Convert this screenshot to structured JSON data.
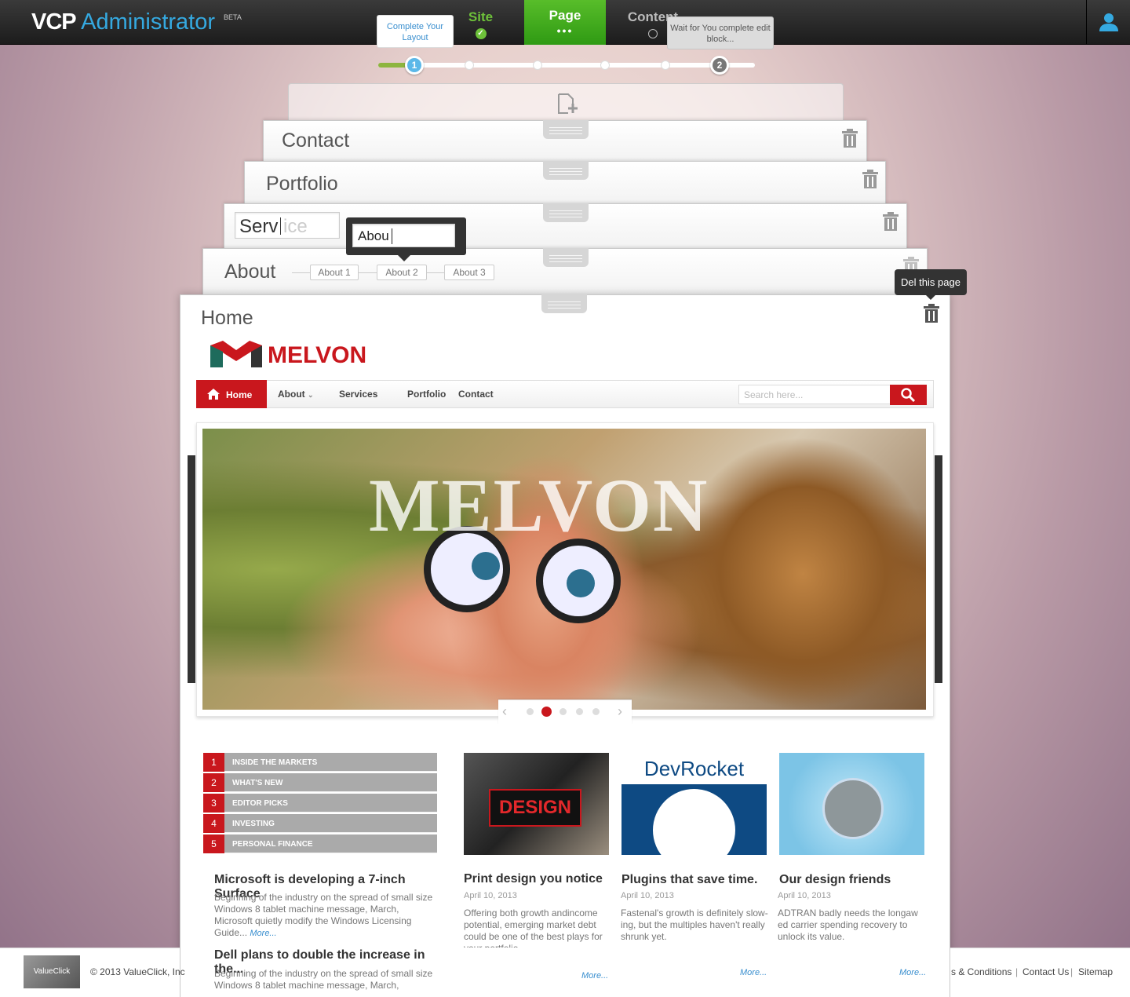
{
  "topbar": {
    "logo_main": "VCP",
    "logo_sub": "Administrator",
    "beta": "BETA",
    "steps": {
      "site": "Site",
      "page": "Page",
      "page_dots": "•••",
      "content": "Content"
    },
    "tip_complete": "Complete Your Layout",
    "tip_wait": "Wait for You complete edit block...",
    "step_markers": [
      "1",
      "2"
    ]
  },
  "pages": {
    "contact": "Contact",
    "portfolio": "Portfolio",
    "service_typed": "Serv",
    "service_ghost": "ice",
    "about": "About",
    "about_subpages": [
      "About 1",
      "About 2",
      "About 3"
    ],
    "about_edit_value": "Abou",
    "home": "Home",
    "del_tooltip": "Del this page"
  },
  "site": {
    "brand": "MELVON",
    "nav": {
      "home": "Home",
      "about": "About",
      "services": "Services",
      "portfolio": "Portfolio",
      "contact": "Contact"
    },
    "search_placeholder": "Search here...",
    "hero_word": "MELVON",
    "slider": {
      "slide_count": 5,
      "active_index": 2
    },
    "news_list": [
      {
        "num": "1",
        "label": "INSIDE THE MARKETS"
      },
      {
        "num": "2",
        "label": "WHAT'S NEW"
      },
      {
        "num": "3",
        "label": "EDITOR PICKS"
      },
      {
        "num": "4",
        "label": "INVESTING"
      },
      {
        "num": "5",
        "label": "PERSONAL FINANCE"
      }
    ],
    "stories": [
      {
        "title": "Microsoft is developing a 7-inch Surface",
        "text": "Beginning of the industry on the spread of small size Windows 8 tablet machine message, March, Microsoft quietly modify the Windows Licensing Guide...",
        "more": "More..."
      },
      {
        "title": "Dell plans to double the increase in the...",
        "text": "Beginning of the industry on the spread of small size Windows 8 tablet machine message, March, Microsoft"
      }
    ],
    "articles": [
      {
        "thumb_text": "DESIGN",
        "title": "Print design you notice",
        "date": "April 10, 2013",
        "text": "Offering both growth andincome potential, emerging market debt could be one of the best plays for your portfolio.",
        "more": "More..."
      },
      {
        "thumb_text": "DevRocket",
        "title": "Plugins that save time.",
        "date": "April 10, 2013",
        "text": "Fastenal's growth is definitely slow-ing, but the multiples haven't really shrunk yet.",
        "more": "More..."
      },
      {
        "title": "Our design friends",
        "date": "April 10, 2013",
        "text": "ADTRAN badly needs the longaw ed carrier spending recovery to unlock its value.",
        "more": "More..."
      }
    ]
  },
  "footer": {
    "logo": "ValueClick",
    "copyright": "© 2013 ValueClick, Inc",
    "links": [
      "s & Conditions",
      "Contact Us",
      "Sitemap"
    ]
  }
}
